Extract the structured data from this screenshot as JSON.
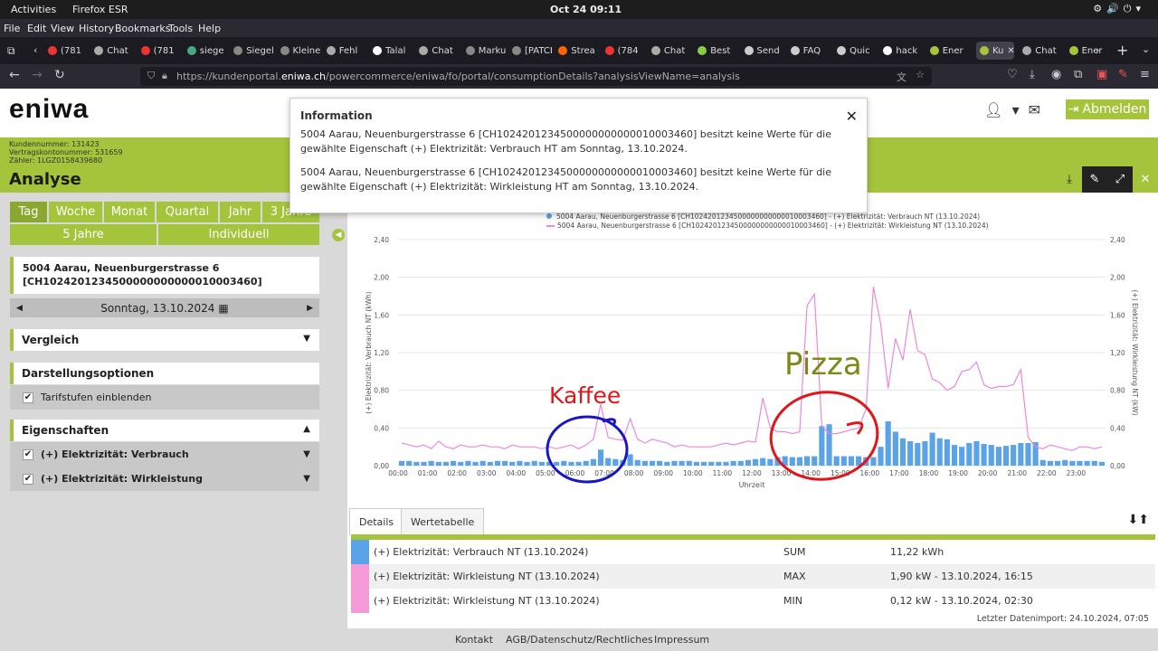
{
  "topbar": {
    "activities": "Activities",
    "browser": "Firefox ESR",
    "clock": "Oct 24  09:11"
  },
  "menu": [
    "File",
    "Edit",
    "View",
    "History",
    "Bookmarks",
    "Tools",
    "Help"
  ],
  "tabs": [
    {
      "label": "(781",
      "color": "#e33"
    },
    {
      "label": "Chat",
      "color": "#aaa"
    },
    {
      "label": "(781",
      "color": "#e33"
    },
    {
      "label": "siege",
      "color": "#4a8"
    },
    {
      "label": "Siegella",
      "color": "#888"
    },
    {
      "label": "Kleiner",
      "color": "#888"
    },
    {
      "label": "Fehl",
      "color": "#aaa"
    },
    {
      "label": "Talal",
      "color": "#fff"
    },
    {
      "label": "Chat",
      "color": "#aaa"
    },
    {
      "label": "Markus",
      "color": "#888"
    },
    {
      "label": "[PATCH",
      "color": "#888"
    },
    {
      "label": "Strea",
      "color": "#f60"
    },
    {
      "label": "(784",
      "color": "#e33"
    },
    {
      "label": "Chat",
      "color": "#aaa"
    },
    {
      "label": "Best",
      "color": "#8c4"
    },
    {
      "label": "Send",
      "color": "#ccc"
    },
    {
      "label": "FAQ",
      "color": "#ccc"
    },
    {
      "label": "Quic",
      "color": "#ccc"
    },
    {
      "label": "hack",
      "color": "#fff"
    },
    {
      "label": "Ener",
      "color": "#a4c43b"
    },
    {
      "label": "Ku",
      "color": "#a4c43b"
    },
    {
      "label": "Chat",
      "color": "#aaa"
    },
    {
      "label": "Ener",
      "color": "#a4c43b"
    }
  ],
  "url": {
    "pre": "https://kundenportal.",
    "host": "eniwa.ch",
    "post": "/powercommerce/eniwa/fo/portal/consumptionDetails?analysisViewName=analysis"
  },
  "logo": "eniwa",
  "abmelden": "Abmelden",
  "customer": {
    "kundennummer": "Kundennummer: 131423",
    "vertrag": "Vertragskontonummer: 531659",
    "zaehler": "Zähler: 1LGZ0158439680"
  },
  "page_title": "Analyse",
  "periods_row1": [
    "Tag",
    "Woche",
    "Monat",
    "Quartal",
    "Jahr",
    "3 Jahre"
  ],
  "periods_row2": [
    "5 Jahre",
    "Individuell"
  ],
  "address": {
    "line1": "5004 Aarau, Neuenburgerstrasse 6",
    "line2": "[CH1024201234500000000000010003460]"
  },
  "date": "Sonntag, 13.10.2024",
  "sections": {
    "vergleich": "Vergleich",
    "darstellung": "Darstellungsoptionen",
    "tarif": "Tarifstufen einblenden",
    "eigenschaften": "Eigenschaften",
    "verbrauch": "(+) Elektrizität: Verbrauch",
    "wirkleistung": "(+) Elektrizität: Wirkleistung"
  },
  "modal": {
    "title": "Information",
    "p1": "5004 Aarau, Neuenburgerstrasse 6 [CH1024201234500000000000010003460] besitzt keine Werte für die gewählte Eigenschaft (+) Elektrizität: Verbrauch HT am Sonntag, 13.10.2024.",
    "p2": "5004 Aarau, Neuenburgerstrasse 6 [CH1024201234500000000000010003460] besitzt keine Werte für die gewählte Eigenschaft (+) Elektrizität: Wirkleistung HT am Sonntag, 13.10.2024."
  },
  "chart_data": {
    "type": "bar",
    "legend": [
      "5004 Aarau, Neuenburgerstrasse 6 [CH1024201234500000000000010003460] - (+) Elektrizität: Verbrauch NT (13.10.2024)",
      "5004 Aarau, Neuenburgerstrasse 6 [CH1024201234500000000000010003460] - (+) Elektrizität: Wirkleistung NT (13.10.2024)"
    ],
    "ylabel_left": "(+) Elektrizität: Verbrauch NT (kWh)",
    "ylabel_right": "(+) Elektrizität: Wirkleistung NT (kW)",
    "xlabel": "Uhrzeit",
    "yticks": [
      "0,00",
      "0,40",
      "0,80",
      "1,20",
      "1,60",
      "2,00",
      "2,40"
    ],
    "ylim": [
      0,
      2.4
    ],
    "xticks": [
      "00:00",
      "01:00",
      "02:00",
      "03:00",
      "04:00",
      "05:00",
      "06:00",
      "07:00",
      "08:00",
      "09:00",
      "10:00",
      "11:00",
      "12:00",
      "13:00",
      "14:00",
      "15:00",
      "16:00",
      "17:00",
      "18:00",
      "19:00",
      "20:00",
      "21:00",
      "22:00",
      "23:00"
    ],
    "consumption": [
      0.05,
      0.05,
      0.04,
      0.04,
      0.05,
      0.04,
      0.04,
      0.05,
      0.04,
      0.05,
      0.04,
      0.05,
      0.04,
      0.05,
      0.05,
      0.04,
      0.05,
      0.04,
      0.05,
      0.04,
      0.04,
      0.04,
      0.05,
      0.04,
      0.04,
      0.05,
      0.07,
      0.17,
      0.08,
      0.07,
      0.06,
      0.12,
      0.06,
      0.05,
      0.05,
      0.05,
      0.04,
      0.05,
      0.05,
      0.05,
      0.04,
      0.04,
      0.04,
      0.04,
      0.04,
      0.05,
      0.05,
      0.06,
      0.07,
      0.08,
      0.07,
      0.09,
      0.1,
      0.09,
      0.09,
      0.1,
      0.1,
      0.42,
      0.44,
      0.1,
      0.1,
      0.1,
      0.1,
      0.09,
      0.09,
      0.2,
      0.47,
      0.36,
      0.29,
      0.26,
      0.24,
      0.26,
      0.35,
      0.29,
      0.28,
      0.22,
      0.2,
      0.24,
      0.26,
      0.23,
      0.22,
      0.2,
      0.21,
      0.22,
      0.24,
      0.24,
      0.25,
      0.06,
      0.05,
      0.05,
      0.06,
      0.05,
      0.05,
      0.05,
      0.05,
      0.04
    ],
    "power": [
      0.24,
      0.22,
      0.2,
      0.22,
      0.18,
      0.26,
      0.2,
      0.18,
      0.22,
      0.2,
      0.2,
      0.22,
      0.2,
      0.2,
      0.18,
      0.22,
      0.2,
      0.2,
      0.2,
      0.18,
      0.2,
      0.18,
      0.2,
      0.22,
      0.18,
      0.22,
      0.28,
      0.65,
      0.3,
      0.28,
      0.27,
      0.5,
      0.28,
      0.24,
      0.28,
      0.26,
      0.24,
      0.2,
      0.22,
      0.2,
      0.2,
      0.2,
      0.2,
      0.22,
      0.24,
      0.22,
      0.24,
      0.26,
      0.25,
      0.72,
      0.4,
      0.36,
      0.36,
      0.34,
      0.36,
      1.7,
      1.82,
      0.42,
      0.34,
      0.34,
      0.36,
      0.38,
      0.4,
      0.6,
      1.9,
      1.5,
      0.82,
      1.35,
      1.12,
      1.66,
      1.22,
      1.18,
      0.92,
      0.88,
      0.8,
      0.84,
      1.0,
      1.02,
      1.1,
      0.86,
      0.82,
      0.84,
      0.84,
      0.86,
      1.02,
      0.3,
      0.2,
      0.18,
      0.22,
      0.2,
      0.18,
      0.16,
      0.2,
      0.2,
      0.18,
      0.2
    ]
  },
  "tabs2": [
    "Details",
    "Wertetabelle"
  ],
  "details": [
    {
      "name": "(+) Elektrizität: Verbrauch NT (13.10.2024)",
      "key": "SUM",
      "value": "11,22 kWh",
      "color": "#5aa3e8"
    },
    {
      "name": "(+) Elektrizität: Wirkleistung NT (13.10.2024)",
      "key": "MAX",
      "value": "1,90 kW - 13.10.2024, 16:15",
      "color": "#f59ad9"
    },
    {
      "name": "(+) Elektrizität: Wirkleistung NT (13.10.2024)",
      "key": "MIN",
      "value": "0,12 kW - 13.10.2024, 02:30",
      "color": "#f59ad9"
    }
  ],
  "last_import": "Letzter Datenimport: 24.10.2024, 07:05",
  "footer": [
    "Kontakt",
    "AGB/Datenschutz/Rechtliches",
    "Impressum"
  ],
  "annotations": {
    "kaffee": "Kaffee",
    "pizza": "Pizza"
  }
}
